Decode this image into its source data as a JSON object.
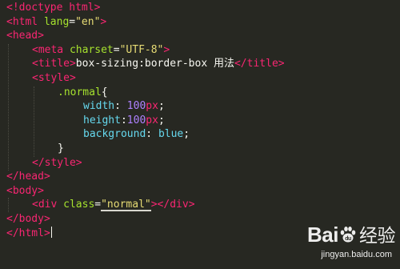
{
  "editor": {
    "lines": [
      {
        "indent": 0,
        "segments": [
          {
            "cls": "tag",
            "text": "<!doctype html>"
          }
        ]
      },
      {
        "indent": 0,
        "segments": [
          {
            "cls": "tag",
            "text": "<html "
          },
          {
            "cls": "attr",
            "text": "lang"
          },
          {
            "cls": "txt",
            "text": "="
          },
          {
            "cls": "str",
            "text": "\"en\""
          },
          {
            "cls": "tag",
            "text": ">"
          }
        ]
      },
      {
        "indent": 0,
        "segments": [
          {
            "cls": "tag",
            "text": "<head>"
          }
        ]
      },
      {
        "indent": 1,
        "segments": [
          {
            "cls": "tag",
            "text": "<meta "
          },
          {
            "cls": "attr",
            "text": "charset"
          },
          {
            "cls": "txt",
            "text": "="
          },
          {
            "cls": "str",
            "text": "\"UTF-8\""
          },
          {
            "cls": "tag",
            "text": ">"
          }
        ]
      },
      {
        "indent": 1,
        "segments": [
          {
            "cls": "tag",
            "text": "<title>"
          },
          {
            "cls": "txt",
            "text": "box-sizing:border-box 用法"
          },
          {
            "cls": "tag",
            "text": "</title>"
          }
        ]
      },
      {
        "indent": 1,
        "segments": [
          {
            "cls": "tag",
            "text": "<style>"
          }
        ]
      },
      {
        "indent": 2,
        "segments": [
          {
            "cls": "sel",
            "text": ".normal"
          },
          {
            "cls": "txt",
            "text": "{"
          }
        ]
      },
      {
        "indent": 3,
        "segments": [
          {
            "cls": "prop",
            "text": "width"
          },
          {
            "cls": "txt",
            "text": ": "
          },
          {
            "cls": "num",
            "text": "100"
          },
          {
            "cls": "unit",
            "text": "px"
          },
          {
            "cls": "txt",
            "text": ";"
          }
        ]
      },
      {
        "indent": 3,
        "segments": [
          {
            "cls": "prop",
            "text": "height"
          },
          {
            "cls": "txt",
            "text": ":"
          },
          {
            "cls": "num",
            "text": "100"
          },
          {
            "cls": "unit",
            "text": "px"
          },
          {
            "cls": "txt",
            "text": ";"
          }
        ]
      },
      {
        "indent": 3,
        "segments": [
          {
            "cls": "prop",
            "text": "background"
          },
          {
            "cls": "txt",
            "text": ": "
          },
          {
            "cls": "prop",
            "text": "blue"
          },
          {
            "cls": "txt",
            "text": ";"
          }
        ]
      },
      {
        "indent": 2,
        "segments": [
          {
            "cls": "txt",
            "text": "}"
          }
        ]
      },
      {
        "indent": 1,
        "segments": [
          {
            "cls": "tag",
            "text": "</style>"
          }
        ]
      },
      {
        "indent": 0,
        "segments": [
          {
            "cls": "tag",
            "text": "</head>"
          }
        ]
      },
      {
        "indent": 0,
        "segments": [
          {
            "cls": "tag",
            "text": "<body>"
          }
        ]
      },
      {
        "indent": 1,
        "segments": [
          {
            "cls": "tag",
            "text": "<div "
          },
          {
            "cls": "attr",
            "text": "class"
          },
          {
            "cls": "txt",
            "text": "="
          },
          {
            "cls": "str hl",
            "text": "\"normal\""
          },
          {
            "cls": "tag",
            "text": "></div>"
          }
        ]
      },
      {
        "indent": 0,
        "segments": [
          {
            "cls": "tag",
            "text": "</body>"
          }
        ]
      },
      {
        "indent": 0,
        "segments": [
          {
            "cls": "tag",
            "text": "</html>"
          }
        ],
        "cursor": true
      }
    ]
  },
  "watermark": {
    "brand_left": "Bai",
    "brand_right": "du",
    "brand_cn": "经验",
    "url": "jingyan.baidu.com"
  },
  "colors": {
    "background": "#272822",
    "tag": "#f92672",
    "attribute": "#a6e22e",
    "string": "#e6db74",
    "property": "#66d9ef",
    "number": "#ae81ff"
  }
}
